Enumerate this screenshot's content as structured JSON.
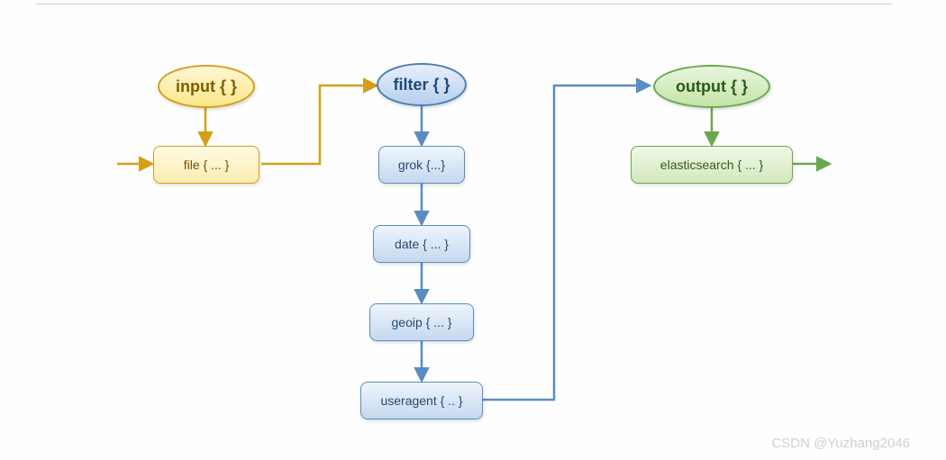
{
  "diagram": {
    "stages": {
      "input": {
        "label": "input { }",
        "child": "file { ... }"
      },
      "filter": {
        "label": "filter { }",
        "plugins": [
          "grok {...}",
          "date { ... }",
          "geoip { ... }",
          "useragent { .. }"
        ]
      },
      "output": {
        "label": "output { }",
        "child": "elasticsearch { ... }"
      }
    }
  },
  "colors": {
    "yellow": "#d4a017",
    "blue": "#5a8cc4",
    "green": "#6aa84f"
  },
  "watermark": "CSDN @Yuzhang2046"
}
